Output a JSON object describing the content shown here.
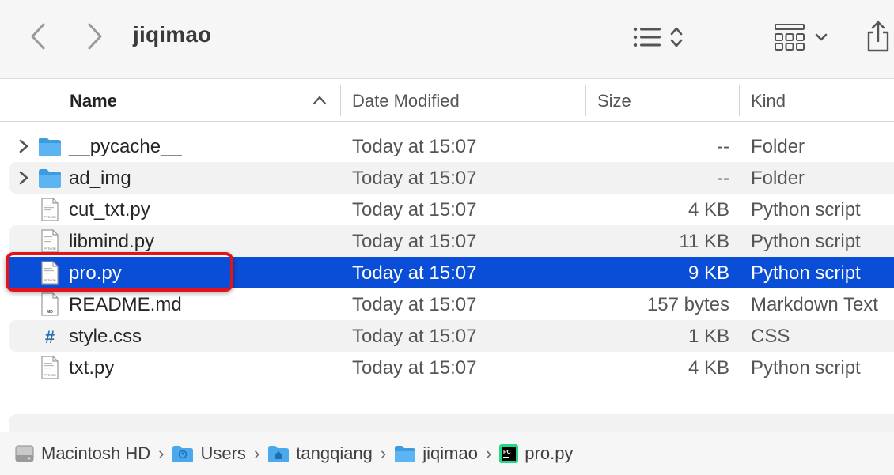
{
  "window": {
    "title": "jiqimao"
  },
  "toolbar": {
    "back_icon": "chevron-left-icon",
    "forward_icon": "chevron-right-icon",
    "list_view_icon": "list-icon",
    "group_icon": "grid-icon",
    "share_icon": "share-icon"
  },
  "columns": {
    "name": "Name",
    "date": "Date Modified",
    "size": "Size",
    "kind": "Kind"
  },
  "files": [
    {
      "name": "__pycache__",
      "date": "Today at 15:07",
      "size": "--",
      "kind": "Folder",
      "type": "folder"
    },
    {
      "name": "ad_img",
      "date": "Today at 15:07",
      "size": "--",
      "kind": "Folder",
      "type": "folder"
    },
    {
      "name": "cut_txt.py",
      "date": "Today at 15:07",
      "size": "4 KB",
      "kind": "Python script",
      "type": "python"
    },
    {
      "name": "libmind.py",
      "date": "Today at 15:07",
      "size": "11 KB",
      "kind": "Python script",
      "type": "python"
    },
    {
      "name": "pro.py",
      "date": "Today at 15:07",
      "size": "9 KB",
      "kind": "Python script",
      "type": "python",
      "selected": true
    },
    {
      "name": "README.md",
      "date": "Today at 15:07",
      "size": "157 bytes",
      "kind": "Markdown Text",
      "type": "markdown"
    },
    {
      "name": "style.css",
      "date": "Today at 15:07",
      "size": "1 KB",
      "kind": "CSS",
      "type": "css"
    },
    {
      "name": "txt.py",
      "date": "Today at 15:07",
      "size": "4 KB",
      "kind": "Python script",
      "type": "python"
    }
  ],
  "path": [
    {
      "label": "Macintosh HD",
      "icon": "hard-drive-icon"
    },
    {
      "label": "Users",
      "icon": "users-folder-icon"
    },
    {
      "label": "tangqiang",
      "icon": "home-folder-icon"
    },
    {
      "label": "jiqimao",
      "icon": "folder-icon"
    },
    {
      "label": "pro.py",
      "icon": "pycharm-icon"
    }
  ],
  "colors": {
    "selection": "#0a4dd6",
    "highlight_border": "#e3131b",
    "folder_blue": "#4aa8ec"
  },
  "icon_labels": {
    "python": "PYTHON",
    "markdown": "MD",
    "css": "#",
    "pycharm": "PC"
  }
}
